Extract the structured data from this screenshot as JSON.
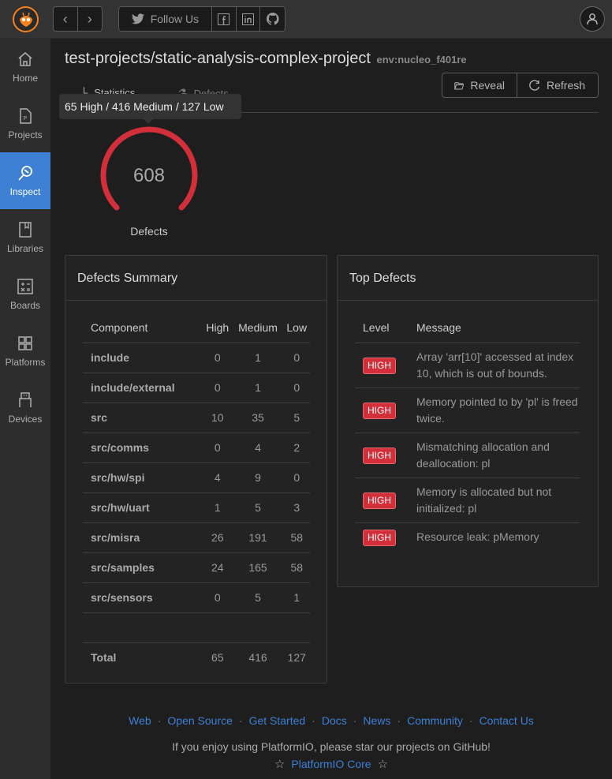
{
  "topbar": {
    "follow_label": "Follow Us",
    "social_icons": [
      "facebook-icon",
      "linkedin-icon",
      "github-icon"
    ]
  },
  "sidebar": {
    "items": [
      {
        "label": "Home",
        "icon": "home-icon",
        "active": false
      },
      {
        "label": "Projects",
        "icon": "projects-icon",
        "active": false
      },
      {
        "label": "Inspect",
        "icon": "inspect-icon",
        "active": true
      },
      {
        "label": "Libraries",
        "icon": "libraries-icon",
        "active": false
      },
      {
        "label": "Boards",
        "icon": "boards-icon",
        "active": false
      },
      {
        "label": "Platforms",
        "icon": "platforms-icon",
        "active": false
      },
      {
        "label": "Devices",
        "icon": "devices-icon",
        "active": false
      }
    ]
  },
  "header": {
    "project": "test-projects/static-analysis-complex-project",
    "env": "env:nucleo_f401re",
    "tabs": [
      {
        "label": "Statistics"
      },
      {
        "label": "Defects"
      }
    ],
    "reveal_label": "Reveal",
    "refresh_label": "Refresh"
  },
  "tooltip": "65 High / 416 Medium / 127 Low",
  "gauge": {
    "value": "608",
    "label": "Defects",
    "fill_fraction": 1.0,
    "color": "#d32f3a"
  },
  "summary": {
    "title": "Defects Summary",
    "columns": [
      "Component",
      "High",
      "Medium",
      "Low"
    ],
    "rows": [
      [
        "include",
        "0",
        "1",
        "0"
      ],
      [
        "include/external",
        "0",
        "1",
        "0"
      ],
      [
        "src",
        "10",
        "35",
        "5"
      ],
      [
        "src/comms",
        "0",
        "4",
        "2"
      ],
      [
        "src/hw/spi",
        "4",
        "9",
        "0"
      ],
      [
        "src/hw/uart",
        "1",
        "5",
        "3"
      ],
      [
        "src/misra",
        "26",
        "191",
        "58"
      ],
      [
        "src/samples",
        "24",
        "165",
        "58"
      ],
      [
        "src/sensors",
        "0",
        "5",
        "1"
      ]
    ],
    "total": [
      "Total",
      "65",
      "416",
      "127"
    ]
  },
  "top_defects": {
    "title": "Top Defects",
    "columns": [
      "Level",
      "Message"
    ],
    "rows": [
      {
        "level": "HIGH",
        "message": "Array 'arr[10]' accessed at index 10, which is out of bounds."
      },
      {
        "level": "HIGH",
        "message": "Memory pointed to by 'pl' is freed twice."
      },
      {
        "level": "HIGH",
        "message": "Mismatching allocation and deallocation: pl"
      },
      {
        "level": "HIGH",
        "message": "Memory is allocated but not initialized: pl"
      },
      {
        "level": "HIGH",
        "message": "Resource leak: pMemory"
      }
    ]
  },
  "footer": {
    "links": [
      "Web",
      "Open Source",
      "Get Started",
      "Docs",
      "News",
      "Community",
      "Contact Us"
    ],
    "note": "If you enjoy using PlatformIO, please star our projects on GitHub!",
    "star_link": "PlatformIO Core"
  }
}
